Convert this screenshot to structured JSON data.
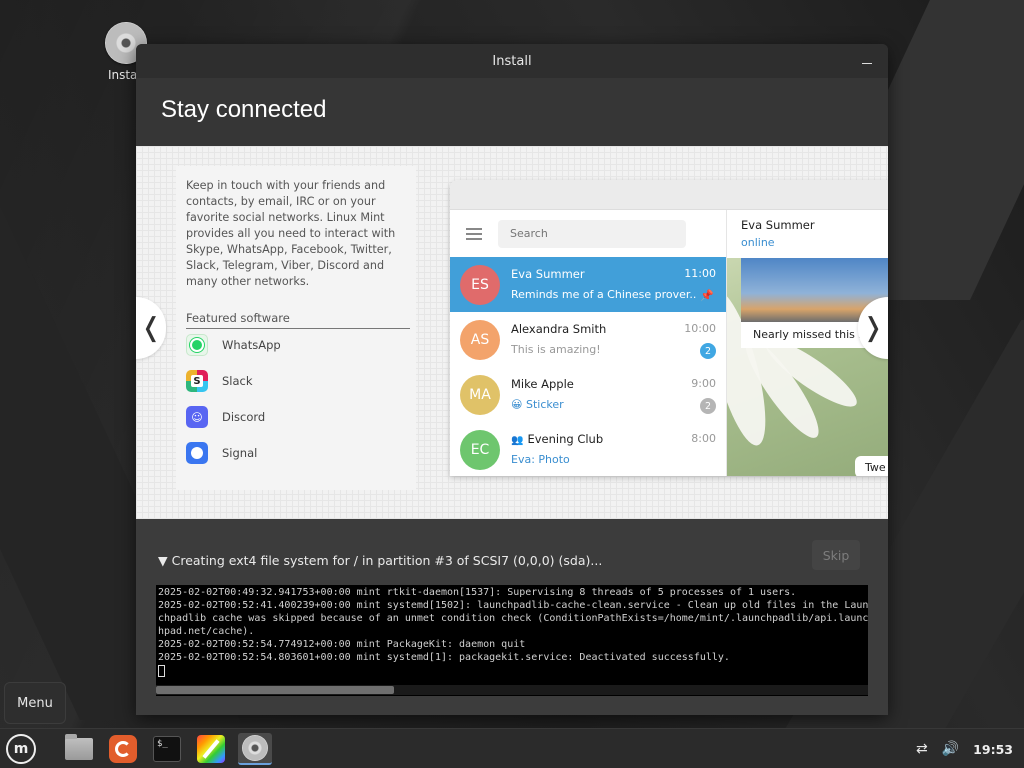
{
  "desktop": {
    "icon_label": "Install"
  },
  "window": {
    "title": "Install",
    "heading": "Stay connected"
  },
  "slide": {
    "intro": "Keep in touch with your friends and contacts, by email, IRC or on your favorite social networks. Linux Mint provides all you need to interact with Skype, WhatsApp, Facebook, Twitter, Slack, Telegram, Viber, Discord and many other networks.",
    "featured_title": "Featured software",
    "featured": [
      {
        "name": "WhatsApp",
        "icon": "whatsapp-icon"
      },
      {
        "name": "Slack",
        "icon": "slack-icon"
      },
      {
        "name": "Discord",
        "icon": "discord-icon"
      },
      {
        "name": "Signal",
        "icon": "signal-icon"
      }
    ],
    "prev_arrow": "❬",
    "next_arrow": "❭"
  },
  "telegram": {
    "search_placeholder": "Search",
    "chats": [
      {
        "initials": "ES",
        "name": "Eva Summer",
        "time": "11:00",
        "message": "Reminds me of a Chinese prover...",
        "avatar_color": "#e06b6b",
        "active": true,
        "pinned": true
      },
      {
        "initials": "AS",
        "name": "Alexandra Smith",
        "time": "10:00",
        "message": "This is amazing!",
        "avatar_color": "#f3a36b",
        "badge": "2",
        "badge_color": "#40a7e3"
      },
      {
        "initials": "MA",
        "name": "Mike Apple",
        "time": "9:00",
        "message": "😀 Sticker",
        "avatar_color": "#e0c268",
        "badge": "2",
        "badge_color": "#b5b5b5"
      },
      {
        "initials": "EC",
        "name": "Evening Club",
        "time": "8:00",
        "message": "Eva: Photo",
        "avatar_color": "#6ec66e"
      }
    ],
    "open_chat": {
      "name": "Eva Summer",
      "status": "online",
      "photo_caption": "Nearly missed this s",
      "bubble": "Twe"
    }
  },
  "progress": {
    "label": "Creating ext4 file system for / in partition #3 of SCSI7 (0,0,0) (sda)...",
    "toggle_glyph": "▼",
    "skip_label": "Skip"
  },
  "log": {
    "lines": [
      "2025-02-02T00:49:32.941753+00:00 mint rtkit-daemon[1537]: Supervising 8 threads of 5 processes of 1 users.",
      "2025-02-02T00:52:41.400239+00:00 mint systemd[1502]: launchpadlib-cache-clean.service - Clean up old files in the Laun",
      "chpadlib cache was skipped because of an unmet condition check (ConditionPathExists=/home/mint/.launchpadlib/api.launc",
      "hpad.net/cache).",
      "2025-02-02T00:52:54.774912+00:00 mint PackageKit: daemon quit",
      "2025-02-02T00:52:54.803601+00:00 mint systemd[1]: packagekit.service: Deactivated successfully."
    ]
  },
  "menu_popup": {
    "label": "Menu"
  },
  "taskbar": {
    "clock": "19:53",
    "apps": [
      "menu-icon",
      "files-icon",
      "firefox-icon",
      "terminal-icon",
      "drawing-icon",
      "installer-icon"
    ],
    "terminal_prompt": "$_"
  },
  "colors": {
    "telegram_active": "#419fd9",
    "online_blue": "#3a8ed0"
  }
}
